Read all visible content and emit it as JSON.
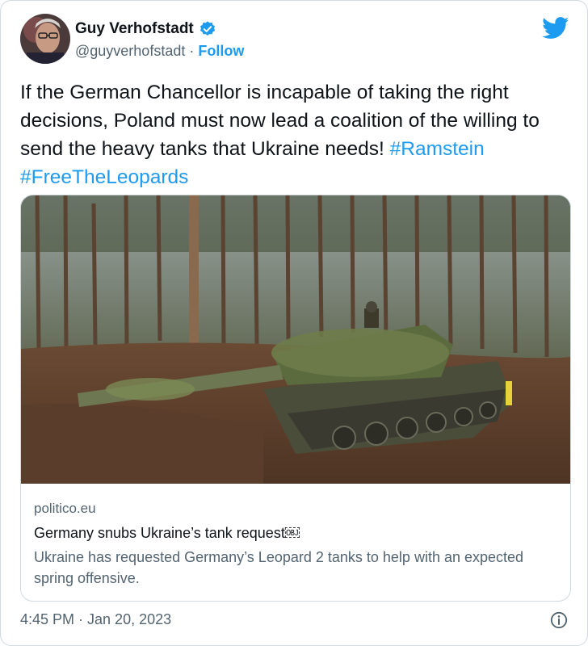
{
  "author": {
    "name": "Guy Verhofstadt",
    "handle": "@guyverhofstadt",
    "separator": "·",
    "follow_label": "Follow"
  },
  "tweet": {
    "text": "If the German Chancellor is incapable of taking the right decisions, Poland must now lead a coalition of the willing to send the heavy tanks that Ukraine needs! ",
    "hashtags": [
      "#Ramstein",
      "#FreeTheLeopards"
    ]
  },
  "link_card": {
    "domain": "politico.eu",
    "title": "Germany snubs Ukraine’s tank request￼",
    "description": "Ukraine has requested Germany’s Leopard 2 tanks to help with an expected spring offensive."
  },
  "meta": {
    "timestamp": "4:45 PM · Jan 20, 2023"
  },
  "icons": {
    "verified": "verified-badge-icon",
    "twitter": "twitter-bird-icon",
    "info": "info-icon"
  },
  "colors": {
    "accent": "#1d9bf0",
    "text": "#0f1419",
    "secondary": "#536471",
    "border": "#cfd9de"
  }
}
